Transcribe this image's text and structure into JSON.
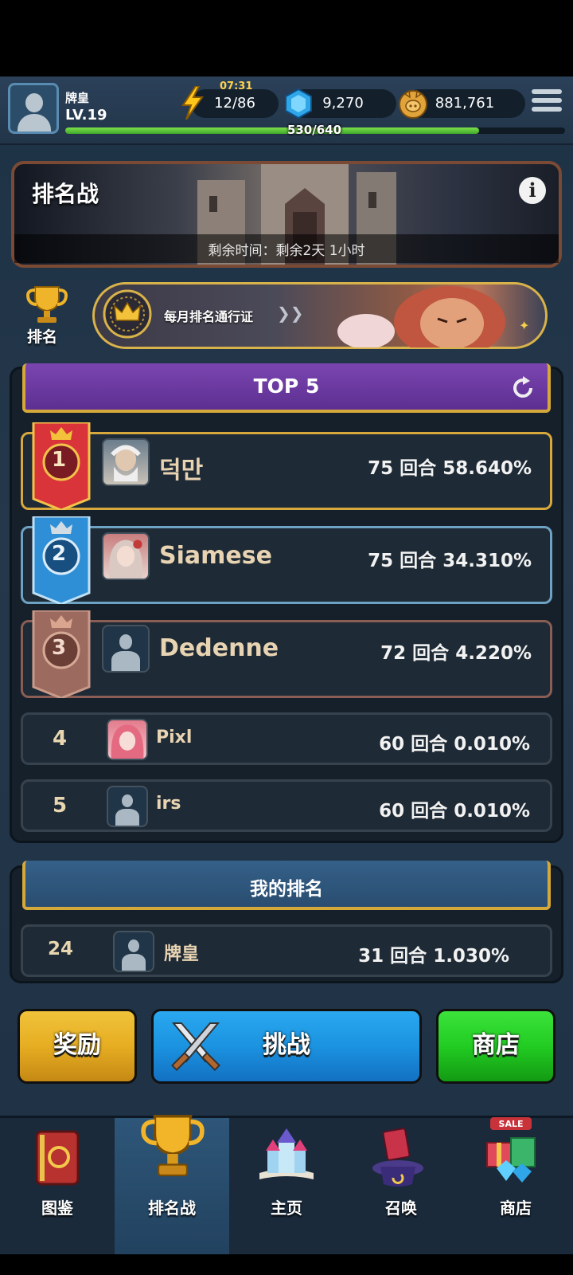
{
  "player": {
    "name": "牌皇",
    "level": "LV.19",
    "xp_text": "530/640",
    "xp_progress": 0.828
  },
  "resources": {
    "energy_timer": "07:31",
    "energy": "12/86",
    "gems": "9,270",
    "gold": "881,761"
  },
  "banner": {
    "title": "排名战",
    "time_remaining": "剩余时间：剩余2天 1小时"
  },
  "rank_label": "排名",
  "pass": {
    "label": "每月排名通行证",
    "arrows": "❯❯"
  },
  "leaderboard": {
    "title": "TOP 5",
    "rows": [
      {
        "rank": "1",
        "name": "덕만",
        "score": "75 回合 58.640%"
      },
      {
        "rank": "2",
        "name": "Siamese",
        "score": "75 回合 34.310%"
      },
      {
        "rank": "3",
        "name": "Dedenne",
        "score": "72 回合 4.220%"
      },
      {
        "rank": "4",
        "name": "Pixl",
        "score": "60 回合 0.010%"
      },
      {
        "rank": "5",
        "name": "irs",
        "score": "60 回合 0.010%"
      }
    ]
  },
  "my_rank": {
    "title": "我的排名",
    "rank": "24",
    "name": "牌皇",
    "score": "31 回合 1.030%"
  },
  "actions": {
    "reward": "奖励",
    "challenge": "挑战",
    "shop": "商店"
  },
  "nav": [
    {
      "label": "图鉴",
      "icon": "book-icon"
    },
    {
      "label": "排名战",
      "icon": "trophy-icon"
    },
    {
      "label": "主页",
      "icon": "castle-icon"
    },
    {
      "label": "召唤",
      "icon": "summon-hat-icon"
    },
    {
      "label": "商店",
      "icon": "gift-sale-icon"
    }
  ],
  "nav_sale_badge": "SALE",
  "colors": {
    "gold_border": "#d7a83d",
    "silver_border": "#6ea2c2",
    "bronze_border": "#8b5e55",
    "purple_header": "#6a3aa0"
  }
}
